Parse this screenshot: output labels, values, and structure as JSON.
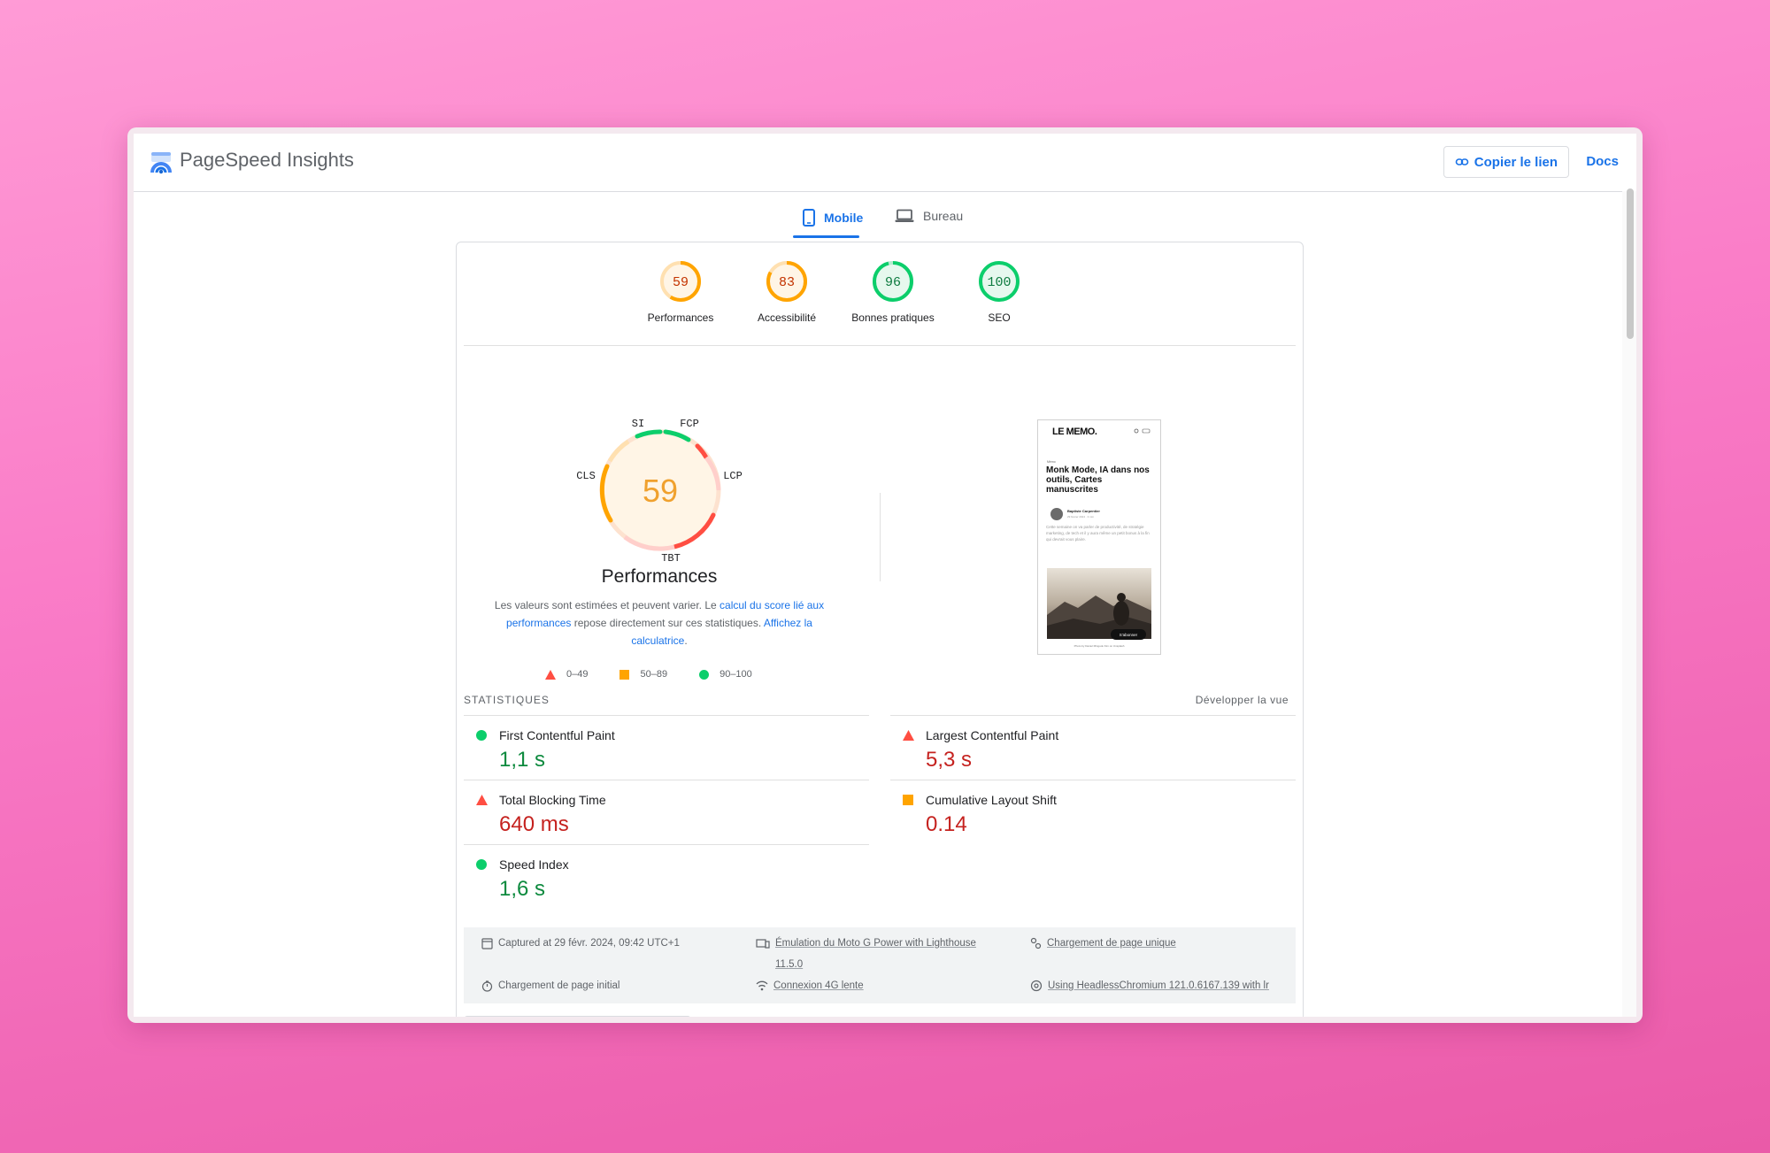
{
  "app": {
    "title": "PageSpeed Insights"
  },
  "header": {
    "copy_link": "Copier le lien",
    "docs": "Docs"
  },
  "tabs": [
    {
      "label": "Mobile",
      "active": true
    },
    {
      "label": "Bureau",
      "active": false
    }
  ],
  "scores": [
    {
      "value": "59",
      "label": "Performances",
      "status": "average"
    },
    {
      "value": "83",
      "label": "Accessibilité",
      "status": "average"
    },
    {
      "value": "96",
      "label": "Bonnes pratiques",
      "status": "good"
    },
    {
      "value": "100",
      "label": "SEO",
      "status": "good"
    }
  ],
  "performance": {
    "score": "59",
    "title": "Performances",
    "segments": {
      "si": "SI",
      "fcp": "FCP",
      "lcp": "LCP",
      "tbt": "TBT",
      "cls": "CLS"
    },
    "desc_1": "Les valeurs sont estimées et peuvent varier. Le ",
    "desc_link_1": "calcul du score lié aux performances",
    "desc_2": " repose directement sur ces statistiques. ",
    "desc_link_2": "Affichez la calculatrice",
    "desc_3": ".",
    "legend": {
      "bad": "0–49",
      "average": "50–89",
      "good": "90–100"
    }
  },
  "preview": {
    "logo": "LE MEMO.",
    "tag": "Mémo",
    "headline": "Monk Mode, IA dans nos outils, Cartes manuscrites",
    "author": "Baptiste Carpentier",
    "date": "29 février 2024 · 3 min",
    "body": "Cette semaine on va parler de productivité, de stratégie marketing, de tech et il y aura même un petit bonus à la fin qui devrait vous plaire.",
    "subscribe": "S'abonner",
    "caption": "Photo by Daniel Mingook Kim on Unsplash"
  },
  "stats": {
    "header": "STATISTIQUES",
    "expand": "Développer la vue",
    "metrics": [
      {
        "name": "First Contentful Paint",
        "value": "1,1 s",
        "status": "good"
      },
      {
        "name": "Largest Contentful Paint",
        "value": "5,3 s",
        "status": "bad"
      },
      {
        "name": "Total Blocking Time",
        "value": "640 ms",
        "status": "bad"
      },
      {
        "name": "Cumulative Layout Shift",
        "value": "0.14",
        "status": "average"
      },
      {
        "name": "Speed Index",
        "value": "1,6 s",
        "status": "good"
      }
    ]
  },
  "info": {
    "captured": "Captured at 29 févr. 2024, 09:42 UTC+1",
    "emulation": "Émulation du Moto G Power with Lighthouse",
    "emulation_version": "11.5.0",
    "single_load": "Chargement de page unique",
    "initial_load": "Chargement de page initial",
    "connection": "Connexion 4G lente",
    "browser": "Using HeadlessChromium 121.0.6167.139 with lr"
  },
  "colors": {
    "good": "#0cce6b",
    "average": "#ffa400",
    "bad": "#ff4e42",
    "link": "#1a73e8"
  }
}
